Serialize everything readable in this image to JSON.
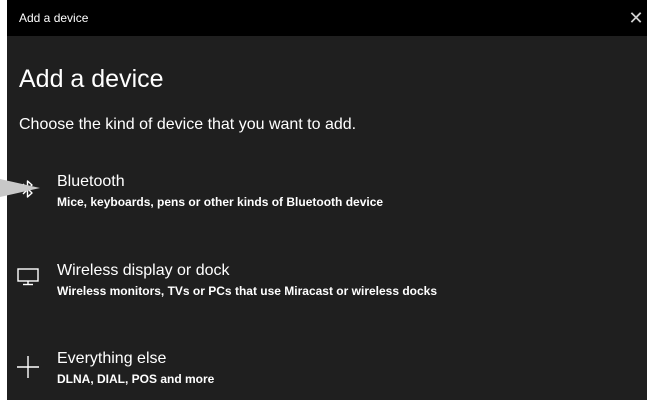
{
  "window": {
    "title": "Add a device",
    "close_icon": "close-icon"
  },
  "main": {
    "heading": "Add a device",
    "subtitle": "Choose the kind of device that you want to add."
  },
  "devices": [
    {
      "name": "Bluetooth",
      "description": "Mice, keyboards, pens or other kinds of Bluetooth device",
      "icon": "bluetooth-icon"
    },
    {
      "name": "Wireless display or dock",
      "description": "Wireless monitors, TVs or PCs that use Miracast or wireless docks",
      "icon": "monitor-icon"
    },
    {
      "name": "Everything else",
      "description": "DLNA, DIAL, POS and more",
      "icon": "plus-icon"
    }
  ],
  "colors": {
    "window_background": "#1f1f1f",
    "titlebar_background": "#000000",
    "text": "#ffffff",
    "pointer_arrow": "#c8c8c8"
  }
}
